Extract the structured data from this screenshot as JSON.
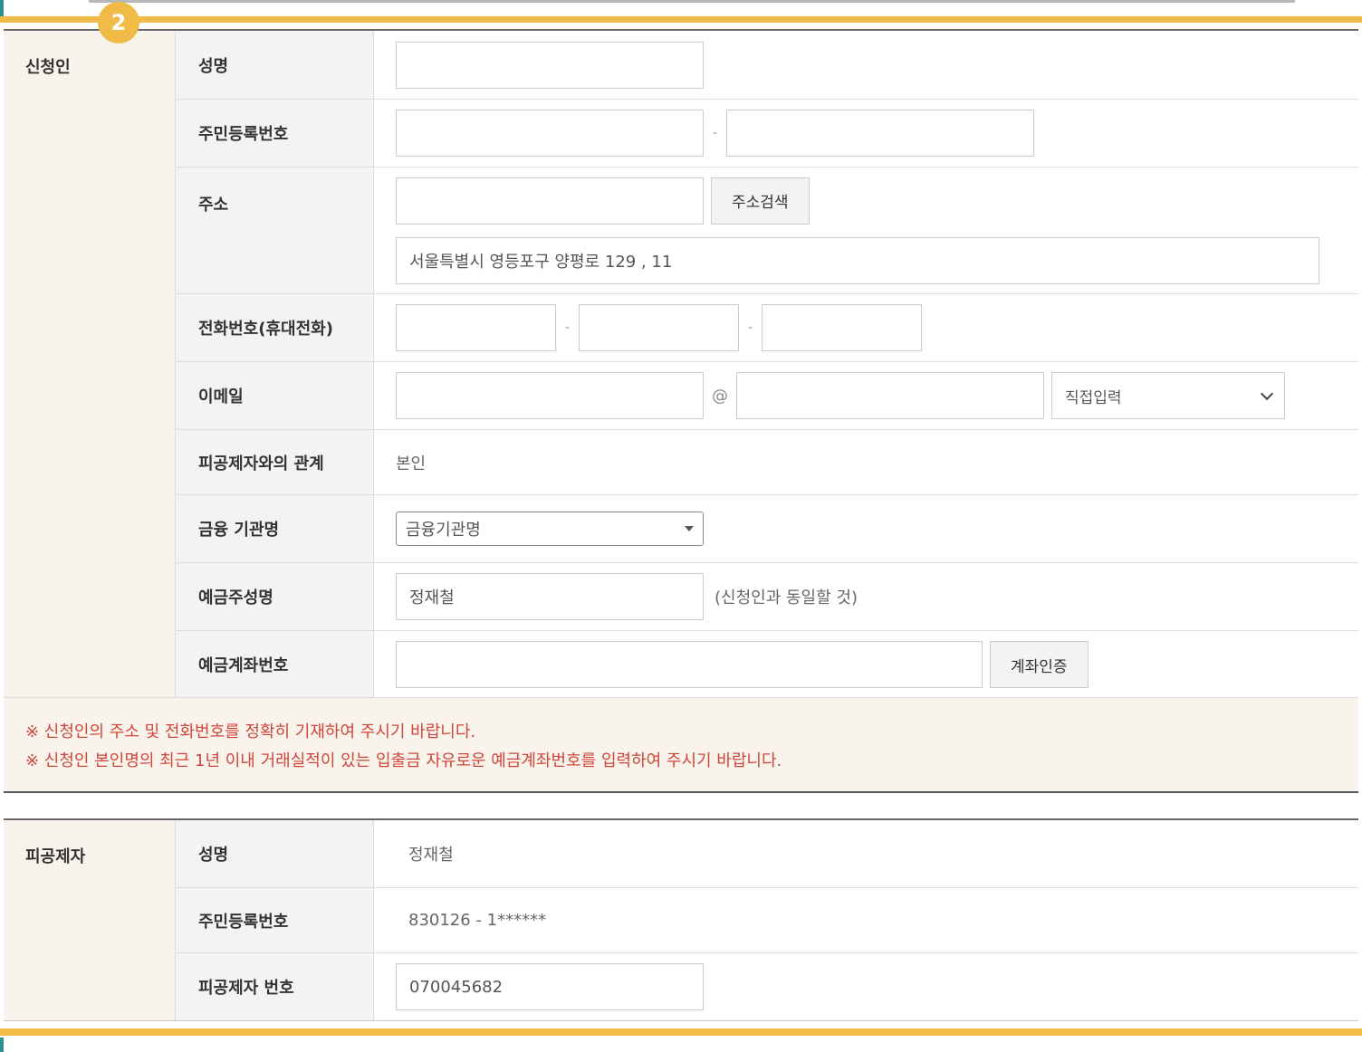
{
  "step_number": "2",
  "applicant": {
    "group_label": "신청인",
    "rows": {
      "name": {
        "label": "성명",
        "value": ""
      },
      "rrn": {
        "label": "주민등록번호",
        "first": "",
        "second": "",
        "separator": "-"
      },
      "address": {
        "label": "주소",
        "zip": "",
        "search_button": "주소검색",
        "detail": "서울특별시 영등포구 양평로 129 , 11"
      },
      "phone": {
        "label": "전화번호(휴대전화)",
        "p1": "",
        "p2": "",
        "p3": "",
        "separator": "-"
      },
      "email": {
        "label": "이메일",
        "local": "",
        "at": "@",
        "domain": "",
        "domain_select": "직접입력"
      },
      "relation": {
        "label": "피공제자와의 관계",
        "value": "본인"
      },
      "bank": {
        "label": "금융 기관명",
        "selected": "금융기관명"
      },
      "holder": {
        "label": "예금주성명",
        "value": "정재철",
        "hint": "(신청인과 동일할 것)"
      },
      "account": {
        "label": "예금계좌번호",
        "value": "",
        "verify_button": "계좌인증"
      }
    },
    "notices": [
      "※ 신청인의 주소 및 전화번호를 정확히 기재하여 주시기 바랍니다.",
      "※ 신청인 본인명의 최근 1년 이내 거래실적이 있는 입출금 자유로운 예금계좌번호를 입력하여 주시기 바랍니다."
    ]
  },
  "insured": {
    "group_label": "피공제자",
    "rows": {
      "name": {
        "label": "성명",
        "value": "정재철"
      },
      "rrn": {
        "label": "주민등록번호",
        "value": "830126 - 1******"
      },
      "number": {
        "label": "피공제자 번호",
        "value": "070045682"
      }
    }
  },
  "colors": {
    "accent_gold": "#f0bb47",
    "teal": "#2d8f8f",
    "notice_red": "#d0453a",
    "label_bg": "#f3f3f3",
    "group_bg": "#f8f4ec"
  }
}
